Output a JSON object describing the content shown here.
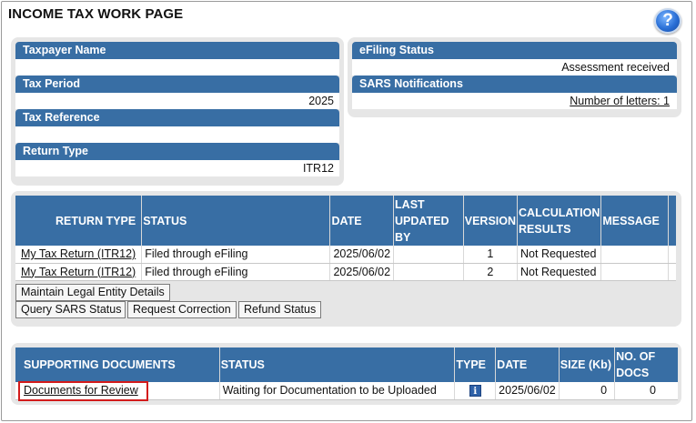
{
  "page": {
    "title": "INCOME TAX WORK PAGE"
  },
  "taxpayer_panel": {
    "taxpayer_name_label": "Taxpayer Name",
    "taxpayer_name_value": "",
    "tax_period_label": "Tax Period",
    "tax_period_value": "2025",
    "tax_reference_label": "Tax Reference",
    "tax_reference_value": "",
    "return_type_label": "Return Type",
    "return_type_value": "ITR12"
  },
  "efiling_panel": {
    "efiling_status_label": "eFiling Status",
    "efiling_status_value": "Assessment received",
    "sars_notifications_label": "SARS Notifications",
    "letters_link": "Number of letters: 1"
  },
  "returns_table": {
    "headers": {
      "return_type": "RETURN TYPE",
      "status": "STATUS",
      "date": "DATE",
      "last_updated_1": "LAST",
      "last_updated_2": "UPDATED",
      "last_updated_3": "BY",
      "version": "VERSION",
      "calc_1": "CALCULATION",
      "calc_2": "RESULTS",
      "message": "MESSAGE"
    },
    "rows": [
      {
        "return_type": "My Tax Return (ITR12)",
        "status": "Filed through eFiling",
        "date": "2025/06/02",
        "last_updated_by": "",
        "version": "1",
        "calculation_results": "Not Requested",
        "message": ""
      },
      {
        "return_type": "My Tax Return (ITR12)",
        "status": "Filed through eFiling",
        "date": "2025/06/02",
        "last_updated_by": "",
        "version": "2",
        "calculation_results": "Not Requested",
        "message": ""
      }
    ]
  },
  "buttons": {
    "maintain_legal_entity": "Maintain Legal Entity Details",
    "query_sars_status": "Query SARS Status",
    "request_correction": "Request Correction",
    "refund_status": "Refund Status"
  },
  "documents_table": {
    "headers": {
      "supporting_documents": "SUPPORTING DOCUMENTS",
      "status": "STATUS",
      "type": "TYPE",
      "date": "DATE",
      "size": "SIZE (Kb)",
      "docs_1": "NO. OF",
      "docs_2": "DOCS"
    },
    "rows": [
      {
        "document": "Documents for Review",
        "status": "Waiting for Documentation to be Uploaded",
        "type_icon": "info-icon",
        "date": "2025/06/02",
        "size": "0",
        "no_of_docs": "0"
      }
    ]
  },
  "colors": {
    "header_blue": "#386ea4",
    "panel_grey": "#e6e6e6",
    "highlight_red": "#d31b1b"
  }
}
